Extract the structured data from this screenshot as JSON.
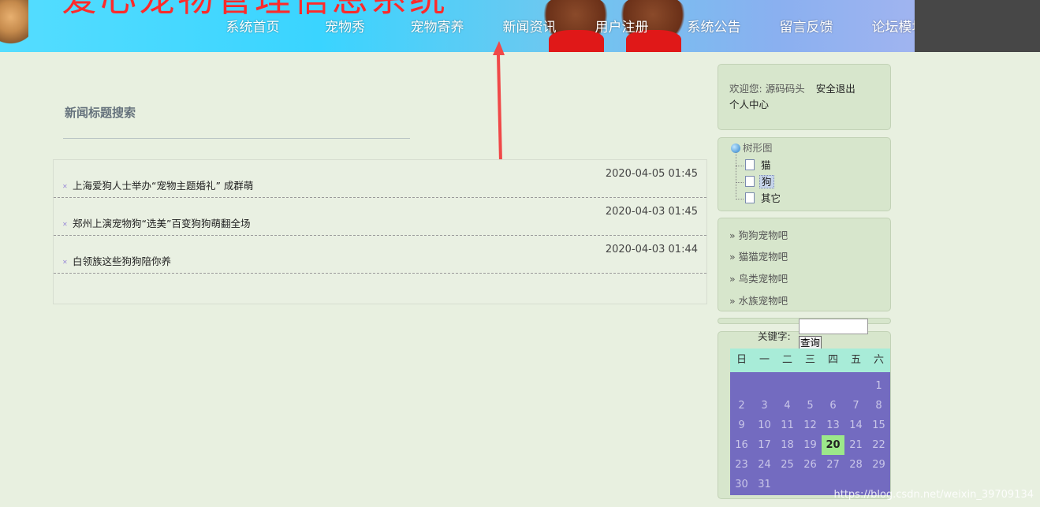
{
  "header": {
    "site_title": "爱心宠物管理信息系统",
    "nav": [
      "系统首页",
      "宠物秀",
      "宠物寄养",
      "新闻资讯",
      "用户注册",
      "系统公告",
      "留言反馈",
      "论坛模块"
    ]
  },
  "search": {
    "title": "新闻标题搜索"
  },
  "news": [
    {
      "title": "上海爱狗人士举办“宠物主题婚礼” 成群萌",
      "date": "2020-04-05 01:45"
    },
    {
      "title": "郑州上演宠物狗“选美”百变狗狗萌翻全场",
      "date": "2020-04-03 01:45"
    },
    {
      "title": "白领族这些狗狗陪你养",
      "date": "2020-04-03 01:44"
    }
  ],
  "welcome": {
    "prefix": "欢迎您:",
    "user": "源码码头",
    "logout": "安全退出",
    "center": "个人中心"
  },
  "tree": {
    "root": "树形图",
    "nodes": [
      "猫",
      "狗",
      "其它"
    ],
    "selected": "狗"
  },
  "links": [
    "» 狗狗宠物吧",
    "» 猫猫宠物吧",
    "» 鸟类宠物吧",
    "» 水族宠物吧"
  ],
  "keyword": {
    "label": "关键字:",
    "value": "",
    "button": "查询"
  },
  "calendar": {
    "weekdays": [
      "日",
      "一",
      "二",
      "三",
      "四",
      "五",
      "六"
    ],
    "first_weekday": 6,
    "days": 31,
    "today": 20
  },
  "watermark": "https://blog.csdn.net/weixin_39709134",
  "colors": {
    "header_cyan": "#3ad4ff",
    "title_red": "#ff2a2a",
    "cal_body": "#736bc0",
    "cal_head": "#a8ecd8",
    "today": "#9ce88a"
  }
}
